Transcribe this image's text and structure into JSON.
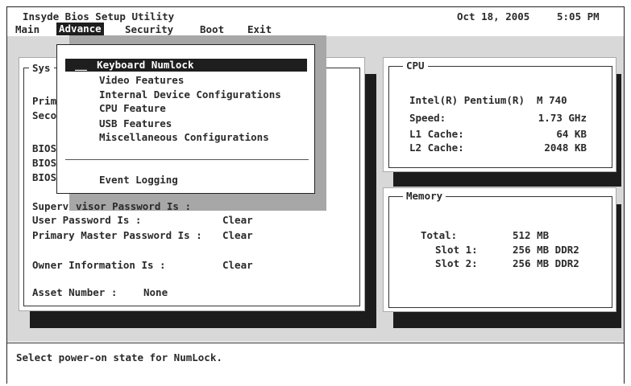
{
  "header": {
    "title": "Insyde Bios Setup Utility",
    "date": "Oct 18, 2005",
    "time": "5:05 PM"
  },
  "menu": [
    "Main",
    "Advance",
    "Security",
    "Boot",
    "Exit"
  ],
  "dropdown": {
    "items": [
      "Keyboard Numlock",
      "Video Features",
      "Internal Device Configurations",
      "CPU Feature",
      "USB Features",
      "Miscellaneous Configurations",
      "Event Logging"
    ],
    "selected_prefix": "__"
  },
  "left_panel": {
    "title_visible": "Sys",
    "partial_rows": [
      "Prim",
      "Seco",
      "BIOS",
      "BIOS",
      "BIOS"
    ],
    "supervisor_prefix": "Superv",
    "supervisor_label": "visor Password Is :",
    "user_password_label": "User Password Is :",
    "user_password_value": "Clear",
    "master_password_label": "Primary Master Password Is :",
    "master_password_value": "Clear",
    "owner_label": "Owner Information Is :",
    "owner_value": "Clear",
    "asset_label": "Asset Number :",
    "asset_value": "None"
  },
  "cpu_panel": {
    "title": "CPU",
    "model": "Intel(R) Pentium(R)  M 740",
    "speed_label": "Speed:",
    "speed_value": "1.73 GHz",
    "l1_label": "L1 Cache:",
    "l1_value": "64 KB",
    "l2_label": "L2 Cache:",
    "l2_value": "2048 KB"
  },
  "memory_panel": {
    "title": "Memory",
    "total_label": "Total:",
    "total_value": "512 MB",
    "slot1_label": "Slot 1:",
    "slot1_value": "256 MB DDR2",
    "slot2_label": "Slot 2:",
    "slot2_value": "256 MB DDR2"
  },
  "status": {
    "text": "Select power-on state for NumLock."
  },
  "colors": {
    "selection_bg": "#1e1e1e",
    "panel_bg": "#d8d8d8",
    "shadow": "#1c1c1c"
  }
}
